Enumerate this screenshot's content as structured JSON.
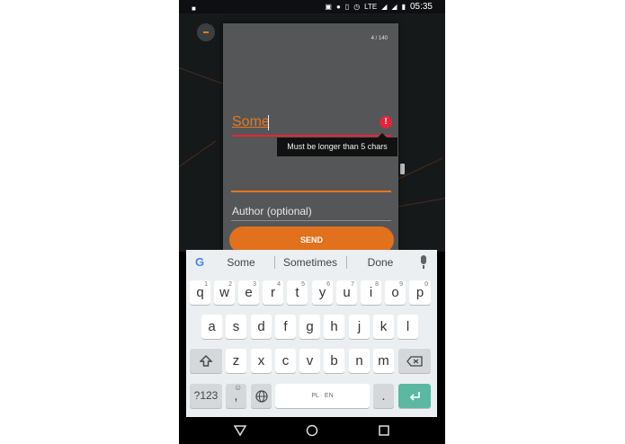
{
  "status_bar": {
    "time": "05:35",
    "network": "LTE"
  },
  "dialog": {
    "counter": "4 / 140",
    "message_value": "Some",
    "error_tooltip": "Must be longer than 5 chars",
    "author_placeholder": "Author (optional)",
    "send_label": "SEND"
  },
  "keyboard": {
    "suggestions": [
      "Some",
      "Sometimes",
      "Done"
    ],
    "row1": [
      {
        "key": "q",
        "hint": "1"
      },
      {
        "key": "w",
        "hint": "2"
      },
      {
        "key": "e",
        "hint": "3"
      },
      {
        "key": "r",
        "hint": "4"
      },
      {
        "key": "t",
        "hint": "5"
      },
      {
        "key": "y",
        "hint": "6"
      },
      {
        "key": "u",
        "hint": "7"
      },
      {
        "key": "i",
        "hint": "8"
      },
      {
        "key": "o",
        "hint": "9"
      },
      {
        "key": "p",
        "hint": "0"
      }
    ],
    "row2": [
      "a",
      "s",
      "d",
      "f",
      "g",
      "h",
      "j",
      "k",
      "l"
    ],
    "row3": [
      "z",
      "x",
      "c",
      "v",
      "b",
      "n",
      "m"
    ],
    "symbols_label": "?123",
    "comma_label": ",",
    "space_label": "PL · EN",
    "period_label": "."
  },
  "icons": {
    "error": "error-icon",
    "google": "google-icon",
    "mic": "mic-icon",
    "shift": "shift-icon",
    "backspace": "backspace-icon",
    "globe": "globe-icon",
    "enter": "enter-icon",
    "back": "back-icon",
    "home": "home-icon",
    "recents": "recents-icon"
  },
  "colors": {
    "accent": "#e2711d",
    "error": "#e5243b",
    "enter": "#5bb8a3"
  }
}
